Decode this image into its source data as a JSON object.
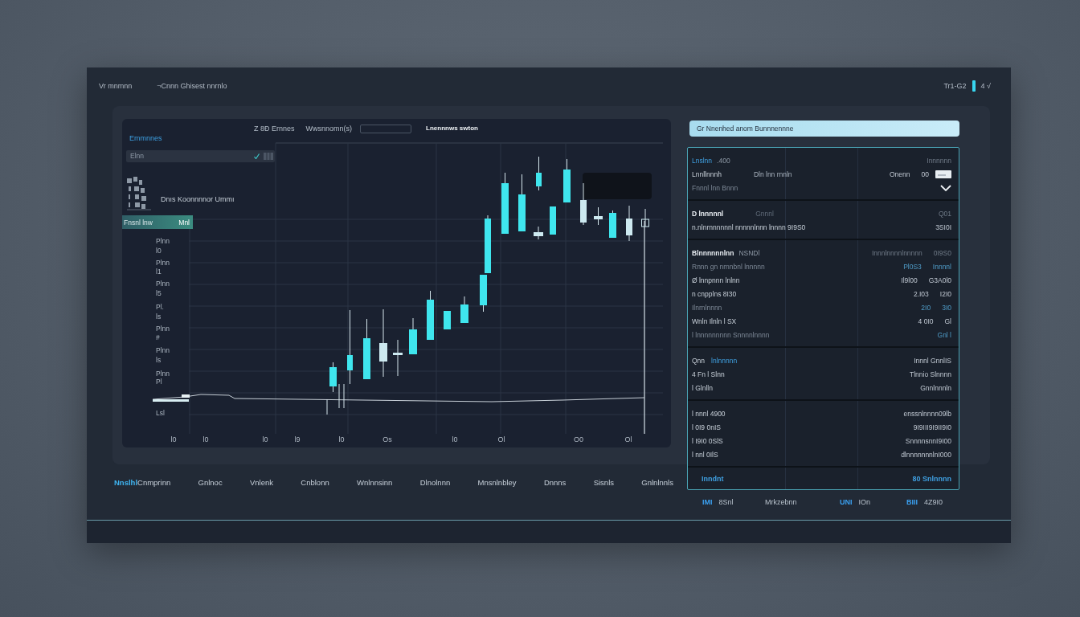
{
  "header": {
    "title": "Vr mnmnn",
    "subtitle": "¬Cnnn Ghisest nnrnlo",
    "status": "Tr1-G2",
    "status_extra": "4 √"
  },
  "chart_panel": {
    "tabs": [
      {
        "label": "Z 8Ð Ernnes",
        "selected": false
      },
      {
        "label": "Wwsnnomn(s)",
        "selected": false
      },
      {
        "label": "Lnennnws swton",
        "selected": true
      }
    ],
    "title": "Emmnnes",
    "search": {
      "value": "Elnn"
    },
    "series_label": "Dnıs Koonnnnor Ummı",
    "highlight_row": {
      "label": "Fnsnl lnw",
      "value": "Mnl"
    },
    "y_labels": [
      "Plnn",
      "l0",
      "Plnn",
      "l1",
      "Plnn",
      "l5",
      "Pl.",
      "ls",
      "Plnn",
      "#",
      "Plnn",
      "ls",
      "Plnn",
      "Pl",
      "Lsl"
    ],
    "x_labels": [
      "l0",
      "l0",
      "l0",
      "l9",
      "l0",
      "Os",
      "l0",
      "Ol",
      "O0",
      "Ol"
    ]
  },
  "side_panel": {
    "banner": "Gr Nnenhed anom Bunnnennne",
    "sections": [
      {
        "rows": [
          {
            "kind": "heading",
            "label": "Lnslnn",
            "note": ".400",
            "values": [
              "Innnnnn"
            ]
          },
          {
            "kind": "row",
            "label": "Lnnllnnnh",
            "mid": "Dln lnn rnnln",
            "values": [
              "Onenn",
              "00"
            ]
          },
          {
            "kind": "dim",
            "label": "Fnnnl lnn Bnnn"
          }
        ]
      },
      {
        "rows": [
          {
            "kind": "subheading",
            "label": "D lnnnnnl",
            "mid": "Gnnnl",
            "values": [
              "Q01"
            ]
          },
          {
            "kind": "row",
            "label": "n.nlnrnnnnnnl nnnnnlnnn lnnnn 9I9S0",
            "values": [
              "3SI0I"
            ]
          }
        ]
      },
      {
        "rows": [
          {
            "kind": "subheading",
            "label": "Blnnnnnnlnn",
            "note": "NSNDl",
            "values": [
              "Innnlnnnnlnnnnn",
              "0I9S0"
            ]
          },
          {
            "kind": "dim",
            "label": "Rnnn gn nrnnbnl lnnnnn",
            "values": [
              "Pl0S3",
              "Innnnl"
            ]
          },
          {
            "kind": "row",
            "label": "Ø lnnpnnn lnlnn",
            "values": [
              "Il9l00",
              "G3A0l0"
            ]
          },
          {
            "kind": "row",
            "label": "n cnpplns 8I30",
            "values": [
              "2.I03",
              "I2I0"
            ]
          },
          {
            "kind": "dim",
            "label": "Ilnrnlnnnn",
            "values": [
              "2I0",
              "3I0"
            ]
          },
          {
            "kind": "row",
            "label": "Wnln Ilnln l SX",
            "values": [
              "4 0I0",
              "Gl"
            ]
          },
          {
            "kind": "dim",
            "label": "l lnnnnnnnnn Snnnnlnnnn",
            "values": [
              "Gnl l"
            ]
          }
        ]
      },
      {
        "rows": [
          {
            "kind": "row",
            "label": "Qnn",
            "accent": "lnlnnnnn",
            "values": [
              "Innnl GnnlIS"
            ]
          },
          {
            "kind": "row",
            "label": "4 Fn l Slnn",
            "values": [
              "Tlnnio Slnnnn"
            ]
          },
          {
            "kind": "row",
            "label": "l Glnlln",
            "values": [
              "Gnnlnnnln"
            ]
          }
        ]
      },
      {
        "rows": [
          {
            "kind": "row",
            "label": "l nnnl 4900",
            "values": [
              "enssnlnnnn09lb"
            ]
          },
          {
            "kind": "row",
            "label": "l 0I9 0nIS",
            "values": [
              "9I9III9I9II9I0"
            ]
          },
          {
            "kind": "row",
            "label": "l I9I0 0SlS",
            "values": [
              "SnnnnsnnI9I00"
            ]
          },
          {
            "kind": "row",
            "label": "l nnl 0IlS",
            "values": [
              "dlnnnnnnnlnI000"
            ]
          }
        ]
      }
    ],
    "footer": {
      "label": "Inndnt",
      "value": "80 Snlnnnn"
    },
    "stats": [
      {
        "label": "IMI",
        "value": "8Snl"
      },
      {
        "value": "Mrkzebnn"
      },
      {
        "label": "UNI",
        "value": "IOn"
      },
      {
        "label": "BIII",
        "value": "4Z9I0"
      }
    ]
  },
  "nav": {
    "brand": "Nnslhl",
    "items": [
      "Cnmprinn",
      "Gnlnoc",
      "Vnlenk",
      "Cnblonn",
      "Wnlnnsinn",
      "Dlnolnnn",
      "Mnsnlnbley",
      "Dnnns",
      "Sisnls",
      "Gnlnlnnls"
    ]
  }
}
